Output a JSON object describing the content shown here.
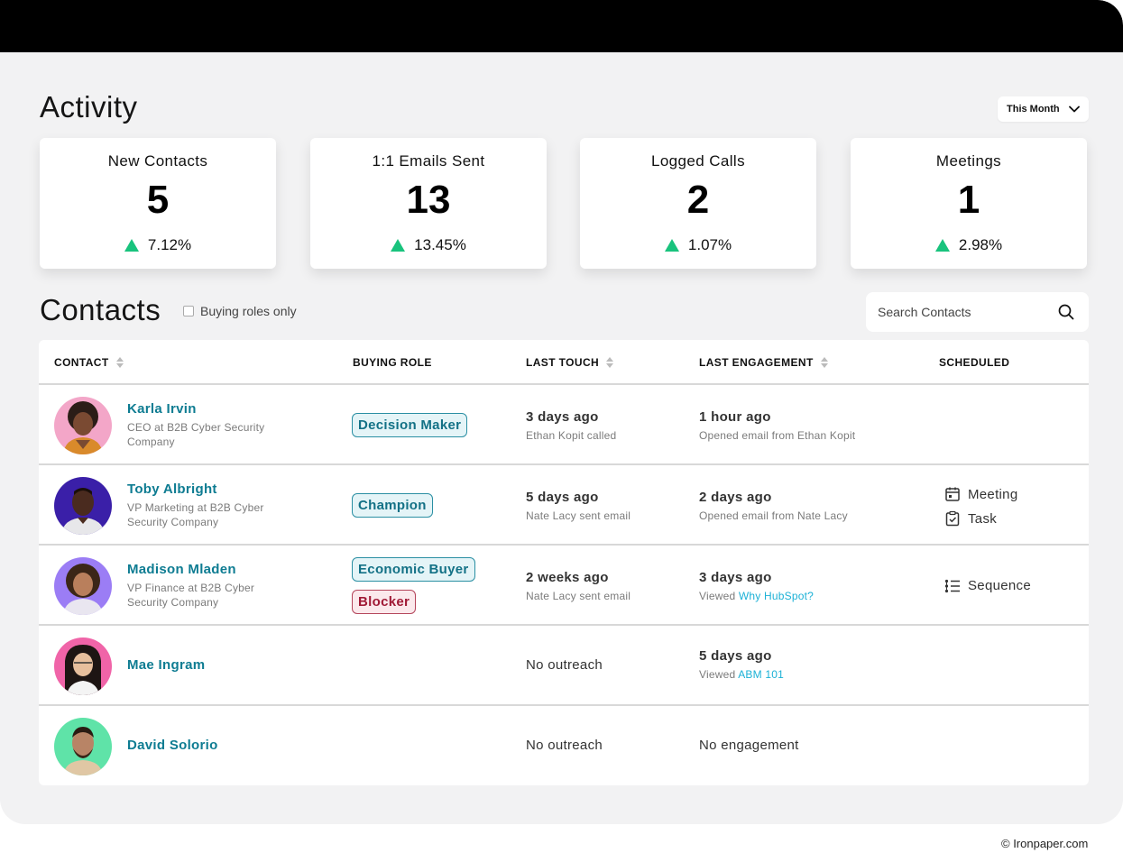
{
  "activity": {
    "title": "Activity",
    "period": "This Month",
    "cards": [
      {
        "label": "New Contacts",
        "value": "5",
        "delta": "7.12%"
      },
      {
        "label": "1:1 Emails Sent",
        "value": "13",
        "delta": "13.45%"
      },
      {
        "label": "Logged Calls",
        "value": "2",
        "delta": "1.07%"
      },
      {
        "label": "Meetings",
        "value": "1",
        "delta": "2.98%"
      }
    ]
  },
  "contacts": {
    "title": "Contacts",
    "filter_label": "Buying roles only",
    "search_placeholder": "Search Contacts",
    "columns": {
      "contact": "CONTACT",
      "buying_role": "BUYING ROLE",
      "last_touch": "LAST TOUCH",
      "last_engagement": "LAST ENGAGEMENT",
      "scheduled": "SCHEDULED"
    },
    "rows": [
      {
        "name": "Karla Irvin",
        "title_line1": "CEO at B2B Cyber Security",
        "title_line2": "Company",
        "roles": [
          "Decision Maker"
        ],
        "touch_main": "3 days ago",
        "touch_sub": "Ethan Kopit called",
        "eng_main": "1 hour ago",
        "eng_sub": "Opened email from Ethan Kopit"
      },
      {
        "name": "Toby Albright",
        "title_line1": "VP Marketing at B2B Cyber",
        "title_line2": "Security Company",
        "roles": [
          "Champion"
        ],
        "touch_main": "5 days ago",
        "touch_sub": "Nate Lacy sent email",
        "eng_main": "2 days ago",
        "eng_sub": "Opened email from Nate Lacy",
        "scheduled": [
          "Meeting",
          "Task"
        ]
      },
      {
        "name": "Madison Mladen",
        "title_line1": "VP Finance at B2B Cyber",
        "title_line2": "Security Company",
        "roles": [
          "Economic Buyer",
          "Blocker"
        ],
        "touch_main": "2 weeks ago",
        "touch_sub": "Nate Lacy sent email",
        "eng_main": "3 days ago",
        "eng_sub_prefix": "Viewed",
        "eng_sub_link": "Why HubSpot?",
        "scheduled": [
          "Sequence"
        ]
      },
      {
        "name": "Mae Ingram",
        "touch_plain": "No outreach",
        "eng_main": "5 days ago",
        "eng_sub_prefix": "Viewed",
        "eng_sub_link": "ABM 101"
      },
      {
        "name": "David Solorio",
        "touch_plain": "No outreach",
        "eng_plain": "No engagement"
      }
    ]
  },
  "colors": {
    "accent_teal": "#0e7c92",
    "positive_green": "#19c37d",
    "blocker_red": "#a01a36",
    "link_cyan": "#1cb1d6"
  },
  "footer": {
    "copyright": "© Ironpaper.com"
  }
}
